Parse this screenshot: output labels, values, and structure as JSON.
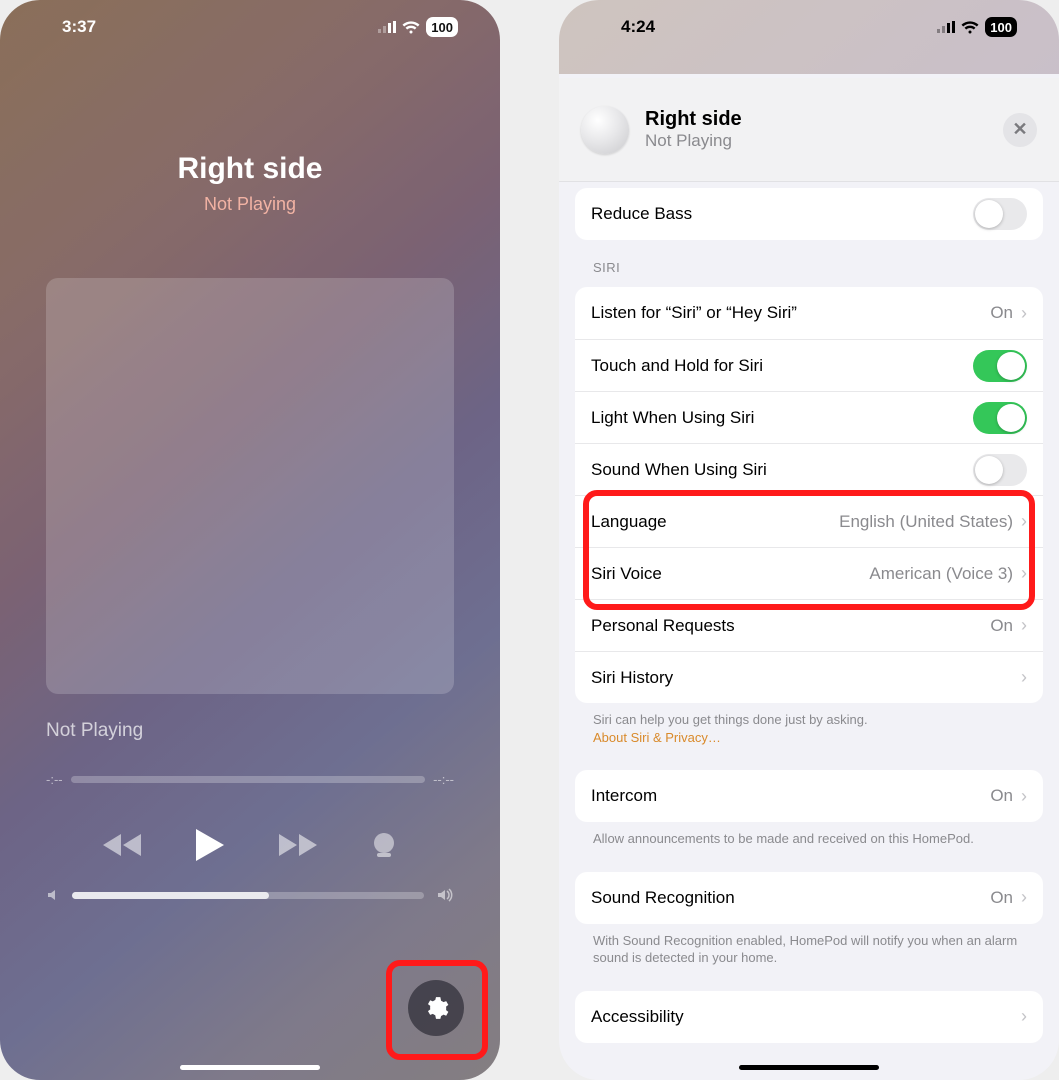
{
  "leftPhone": {
    "status": {
      "time": "3:37",
      "battery": "100"
    },
    "title": "Right side",
    "subtitle": "Not Playing",
    "notPlaying": "Not Playing",
    "elapsed": "-:--",
    "remaining": "--:--"
  },
  "rightPhone": {
    "status": {
      "time": "4:24",
      "battery": "100"
    },
    "header": {
      "title": "Right side",
      "subtitle": "Not Playing"
    },
    "reduceBass": {
      "label": "Reduce Bass",
      "on": false
    },
    "siriSection": "SIRI",
    "siri": {
      "listen": {
        "label": "Listen for “Siri” or “Hey Siri”",
        "value": "On"
      },
      "touchHold": {
        "label": "Touch and Hold for Siri",
        "on": true
      },
      "light": {
        "label": "Light When Using Siri",
        "on": true
      },
      "sound": {
        "label": "Sound When Using Siri",
        "on": false
      },
      "language": {
        "label": "Language",
        "value": "English (United States)"
      },
      "voice": {
        "label": "Siri Voice",
        "value": "American (Voice 3)"
      },
      "personal": {
        "label": "Personal Requests",
        "value": "On"
      },
      "history": {
        "label": "Siri History"
      }
    },
    "siriFoot": "Siri can help you get things done just by asking.",
    "siriFootLink": "About Siri & Privacy…",
    "intercom": {
      "label": "Intercom",
      "value": "On"
    },
    "intercomFoot": "Allow announcements to be made and received on this HomePod.",
    "soundRec": {
      "label": "Sound Recognition",
      "value": "On"
    },
    "soundRecFoot": "With Sound Recognition enabled, HomePod will notify you when an alarm sound is detected in your home.",
    "accessibility": {
      "label": "Accessibility"
    }
  }
}
